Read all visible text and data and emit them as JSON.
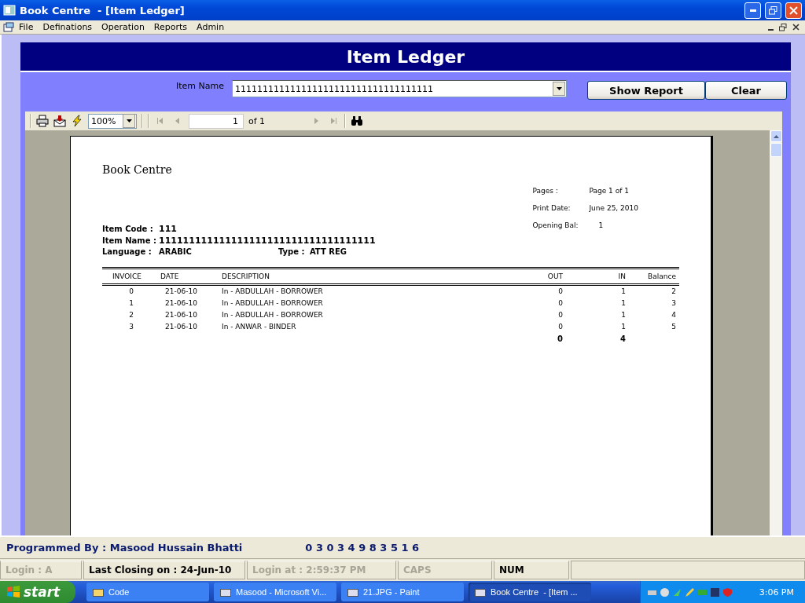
{
  "window": {
    "title": "Book Centre  - [Item Ledger]"
  },
  "menu": [
    "File",
    "Definations",
    "Operation",
    "Reports",
    "Admin"
  ],
  "form": {
    "title": "Item Ledger",
    "item_label": "Item Name",
    "item_value": "111111111111111111111111111111111111",
    "buttons": [
      "Show Report",
      "Clear"
    ]
  },
  "viewer_toolbar": {
    "zoom": "100%",
    "page": "1",
    "page_of": "of 1"
  },
  "report": {
    "company": "Book Centre",
    "info": [
      {
        "label": "Pages :",
        "value": "Page 1 of 1"
      },
      {
        "label": "Print Date:",
        "value": "June 25, 2010"
      },
      {
        "label": "Opening Bal:",
        "value": "1"
      }
    ],
    "item_code": {
      "label": "Item Code :",
      "value": "111"
    },
    "item_name": {
      "label": "Item Name :",
      "value": "111111111111111111111111111111111111"
    },
    "language": {
      "label": "Language :",
      "value": "ARABIC"
    },
    "type": {
      "label": "Type :",
      "value": "ATT REG"
    },
    "columns": [
      "INVOICE",
      "DATE",
      "DESCRIPTION",
      "OUT",
      "IN",
      "Balance"
    ],
    "rows": [
      [
        "0",
        "21-06-10",
        "In - ABDULLAH - BORROWER",
        "0",
        "1",
        "2"
      ],
      [
        "1",
        "21-06-10",
        "In - ABDULLAH - BORROWER",
        "0",
        "1",
        "3"
      ],
      [
        "2",
        "21-06-10",
        "In - ABDULLAH - BORROWER",
        "0",
        "1",
        "4"
      ],
      [
        "3",
        "21-06-10",
        "In - ANWAR - BINDER",
        "0",
        "1",
        "5"
      ]
    ],
    "totals": {
      "out": "0",
      "in": "4"
    }
  },
  "credit": {
    "name": "Programmed By : Masood Hussain Bhatti",
    "phone": "0 3 0 3 4 9 8 3 5 1 6"
  },
  "status_bar": [
    {
      "text": "Login :  A",
      "active": false
    },
    {
      "text": "Last Closing on : 24-Jun-10",
      "active": true
    },
    {
      "text": "Login at : 2:59:37 PM",
      "active": false
    },
    {
      "text": "CAPS",
      "active": false
    },
    {
      "text": "NUM",
      "active": true
    }
  ],
  "taskbar": {
    "start": "start",
    "items": [
      {
        "label": "Code",
        "selected": false
      },
      {
        "label": "Masood - Microsoft Vi...",
        "selected": false
      },
      {
        "label": "21.JPG - Paint",
        "selected": false
      },
      {
        "label": "Book Centre  - [Item ...",
        "selected": true
      }
    ],
    "clock": "3:06 PM"
  }
}
